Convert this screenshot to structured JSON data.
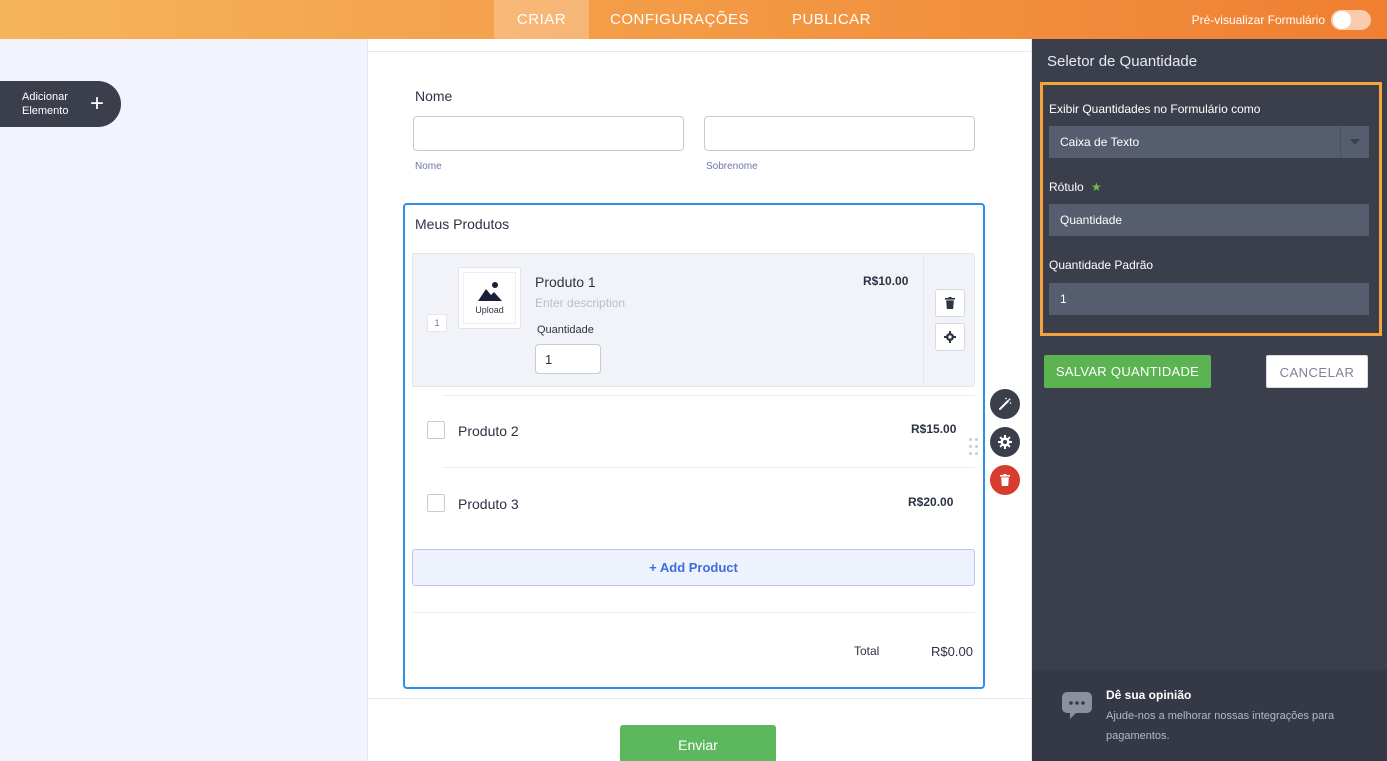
{
  "topbar": {
    "tabs": [
      {
        "label": "CRIAR",
        "active": true
      },
      {
        "label": "CONFIGURAÇÕES",
        "active": false
      },
      {
        "label": "PUBLICAR",
        "active": false
      }
    ],
    "preview_label": "Pré-visualizar Formulário"
  },
  "add_element": {
    "label": "Adicionar Elemento",
    "icon": "plus-icon"
  },
  "form": {
    "name_field": {
      "label": "Nome",
      "first_sublabel": "Nome",
      "last_sublabel": "Sobrenome",
      "first_value": "",
      "last_value": ""
    },
    "products": {
      "title": "Meus Produtos",
      "items": [
        {
          "name": "Produto 1",
          "price": "R$10.00",
          "description_placeholder": "Enter description",
          "upload_label": "Upload",
          "qty_label": "Quantidade",
          "qty_value": "1",
          "badge": "1"
        },
        {
          "name": "Produto 2",
          "price": "R$15.00"
        },
        {
          "name": "Produto 3",
          "price": "R$20.00"
        }
      ],
      "add_label": "+ Add Product",
      "total_label": "Total",
      "total_value": "R$0.00"
    },
    "submit_label": "Enviar"
  },
  "panel": {
    "title": "Seletor de Quantidade",
    "display_label": "Exibir Quantidades no Formulário como",
    "display_value": "Caixa de Texto",
    "label_label": "Rótulo",
    "required_mark": "★",
    "label_value": "Quantidade",
    "default_label": "Quantidade Padrão",
    "default_value": "1",
    "save_label": "SALVAR QUANTIDADE",
    "cancel_label": "CANCELAR",
    "feedback_title": "Dê sua opinião",
    "feedback_text": "Ajude-nos a melhorar nossas integrações para pagamentos."
  },
  "colors": {
    "accent": "#f5a33a",
    "selection": "#2e8fe6",
    "success": "#5bb352",
    "danger": "#d63d2f",
    "panel_bg": "#3a3f4b"
  }
}
